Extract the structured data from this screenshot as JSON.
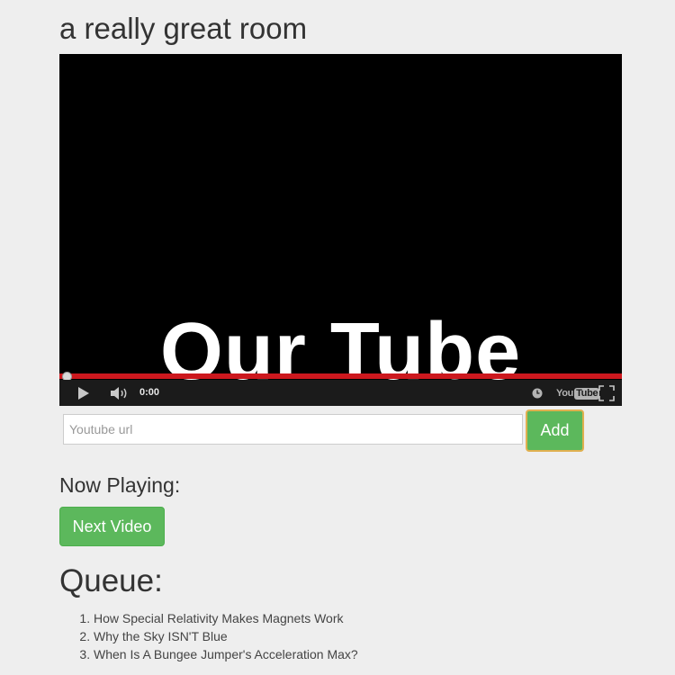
{
  "room": {
    "title": "a really great room"
  },
  "player": {
    "overlay_title": "Our Tube",
    "time": "0:00",
    "progress": 0,
    "logo_you": "You",
    "logo_tube": "Tube",
    "icons": {
      "play": "play-icon",
      "volume": "volume-icon",
      "watch_later": "clock-icon",
      "fullscreen": "fullscreen-icon"
    },
    "colors": {
      "background": "#000000",
      "progress": "#cc181e",
      "control_bar": "#1b1b1b"
    }
  },
  "url_form": {
    "placeholder": "Youtube url",
    "value": "",
    "add_label": "Add"
  },
  "now_playing": {
    "heading": "Now Playing:",
    "next_label": "Next Video"
  },
  "queue": {
    "heading": "Queue:",
    "items": [
      "How Special Relativity Makes Magnets Work",
      "Why the Sky ISN'T Blue",
      "When Is A Bungee Jumper's Acceleration Max?"
    ]
  },
  "theme": {
    "page_background": "#eeeeee",
    "button_green": "#5cb85c",
    "focus_outline": "#e0b050"
  }
}
